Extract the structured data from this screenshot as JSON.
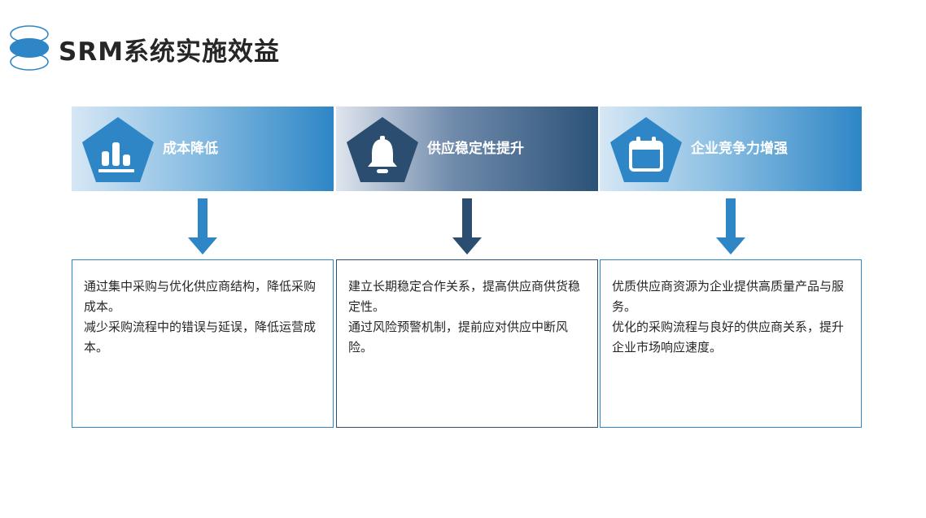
{
  "title": "SRM系统实施效益",
  "colors": {
    "blue": "#2e86c6",
    "navy": "#2b4d70"
  },
  "columns": [
    {
      "heading": "成本降低",
      "icon": "bar-chart-icon",
      "lines": [
        "通过集中采购与优化供应商结构，降低采购成本。",
        "减少采购流程中的错误与延误，降低运营成本。"
      ]
    },
    {
      "heading": "供应稳定性提升",
      "icon": "bell-icon",
      "lines": [
        "建立长期稳定合作关系，提高供应商供货稳定性。",
        "通过风险预警机制，提前应对供应中断风险。"
      ]
    },
    {
      "heading": "企业竞争力增强",
      "icon": "calendar-icon",
      "lines": [
        "优质供应商资源为企业提供高质量产品与服务。",
        "优化的采购流程与良好的供应商关系，提升企业市场响应速度。"
      ]
    }
  ]
}
